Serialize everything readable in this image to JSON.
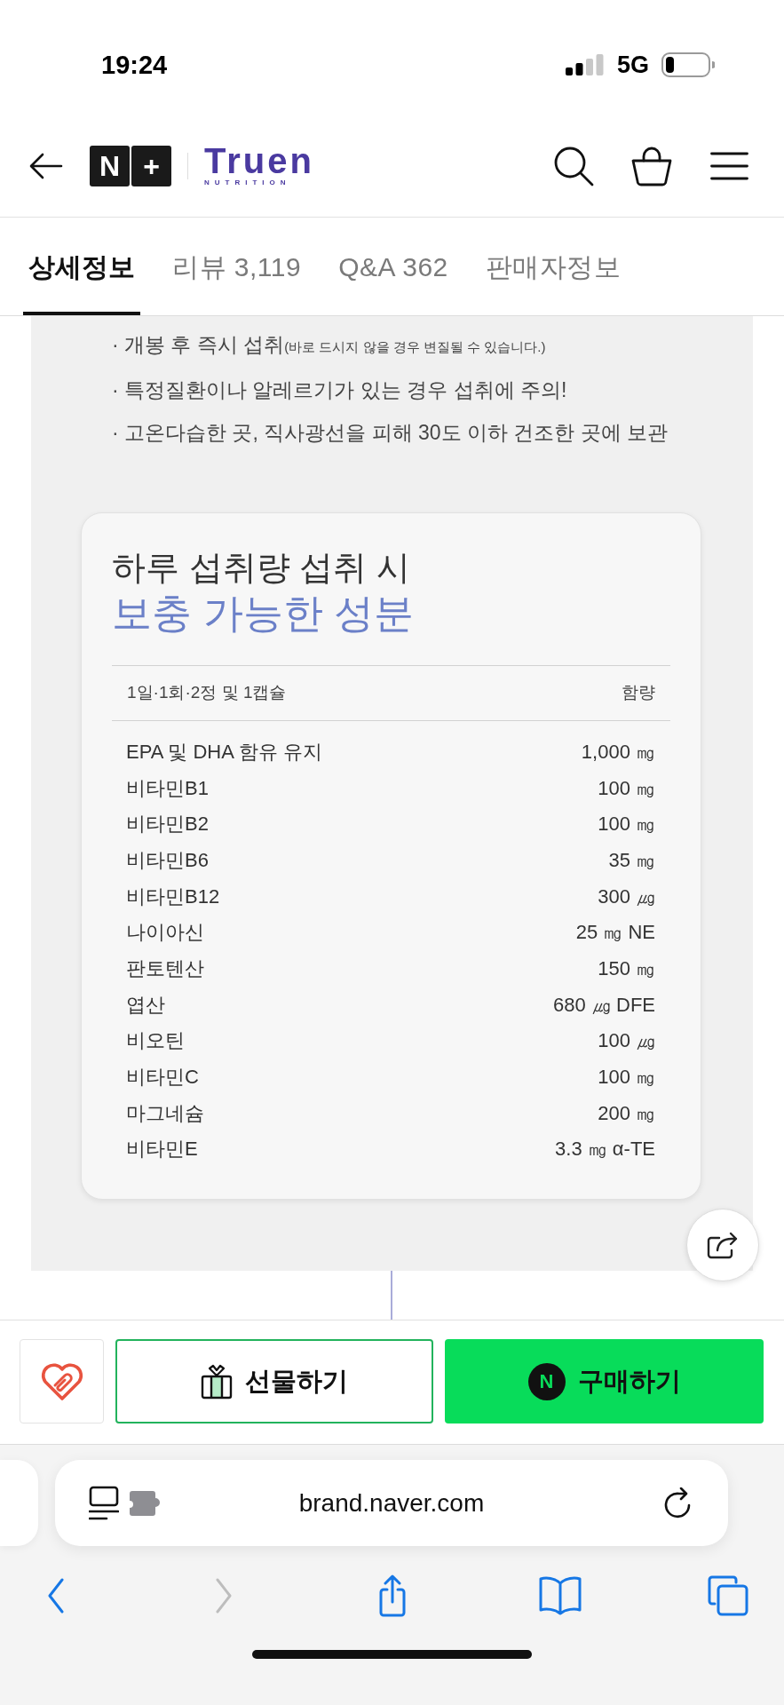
{
  "status_bar": {
    "time": "19:24",
    "network": "5G"
  },
  "header": {
    "badge": [
      "N",
      "+"
    ],
    "brand": {
      "name": "Truen",
      "tagline": "NUTRITION"
    }
  },
  "tabs": [
    {
      "label": "상세정보",
      "selected": true
    },
    {
      "label": "리뷰 3,119",
      "selected": false
    },
    {
      "label": "Q&A 362",
      "selected": false
    },
    {
      "label": "판매자정보",
      "selected": false
    }
  ],
  "notes": [
    {
      "text": "· 개봉 후 즉시 섭취",
      "aside": "(바로 드시지 않을 경우 변질될 수 있습니다.)"
    },
    {
      "text": "· 특정질환이나 알레르기가 있는 경우 섭취에 주의!"
    },
    {
      "text": "· 고온다습한 곳, 직사광선을 피해 30도 이하 건조한 곳에 보관"
    }
  ],
  "nutrition_card": {
    "title": "하루 섭취량 섭취 시",
    "subtitle": "보충 가능한 성분",
    "columns": [
      "1일·1회·2정 및 1캡슐",
      "함량"
    ],
    "rows": [
      {
        "name": "EPA 및 DHA 함유 유지",
        "amount": "1,000 ㎎"
      },
      {
        "name": "비타민B1",
        "amount": "100 ㎎"
      },
      {
        "name": "비타민B2",
        "amount": "100 ㎎"
      },
      {
        "name": "비타민B6",
        "amount": "35 ㎎"
      },
      {
        "name": "비타민B12",
        "amount": "300 ㎍"
      },
      {
        "name": "나이아신",
        "amount": "25 ㎎ NE"
      },
      {
        "name": "판토텐산",
        "amount": "150 ㎎"
      },
      {
        "name": "엽산",
        "amount": "680 ㎍ DFE"
      },
      {
        "name": "비오틴",
        "amount": "100 ㎍"
      },
      {
        "name": "비타민C",
        "amount": "100 ㎎"
      },
      {
        "name": "마그네슘",
        "amount": "200 ㎎"
      },
      {
        "name": "비타민E",
        "amount": "3.3 ㎎ α-TE"
      }
    ]
  },
  "purchase_bar": {
    "gift_button": "선물하기",
    "buy_button": {
      "badge": "N",
      "label": "구매하기"
    }
  },
  "browser": {
    "url": "brand.naver.com",
    "toolbar": [
      {
        "kind": "back",
        "disabled": false
      },
      {
        "kind": "forward",
        "disabled": true
      },
      {
        "kind": "share",
        "disabled": false
      },
      {
        "kind": "bookmarks",
        "disabled": false
      },
      {
        "kind": "tabs",
        "disabled": false
      }
    ]
  }
}
